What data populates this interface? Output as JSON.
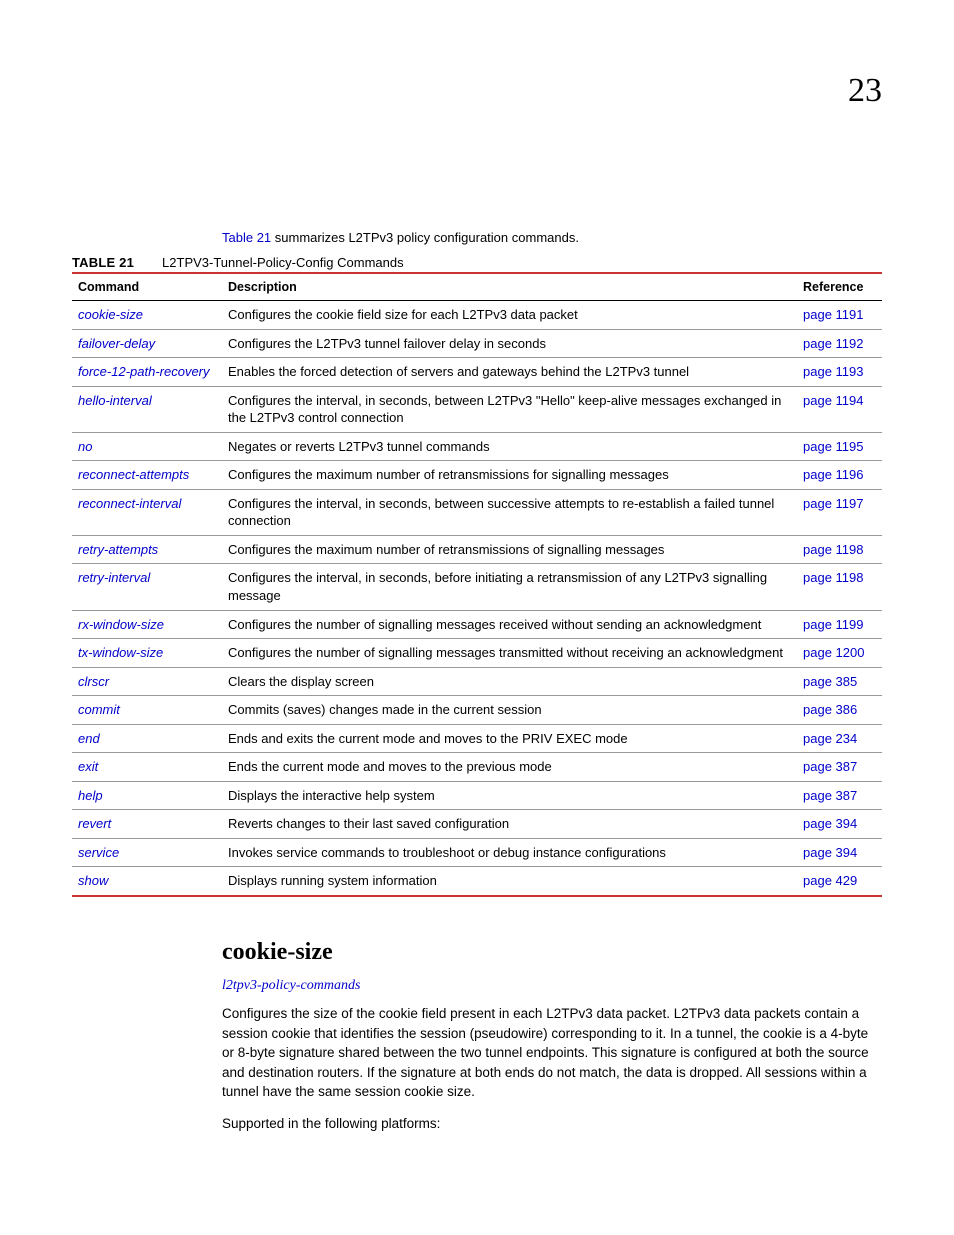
{
  "chapter": "23",
  "intro": {
    "link": "Table 21",
    "rest": " summarizes L2TPv3 policy configuration commands."
  },
  "table": {
    "label": "TABLE 21",
    "title": "L2TPV3-Tunnel-Policy-Config Commands",
    "headers": {
      "cmd": "Command",
      "desc": "Description",
      "ref": "Reference"
    },
    "rows": [
      {
        "cmd": "cookie-size",
        "desc": "Configures the cookie field size for each L2TPv3 data packet",
        "ref": "page 1191"
      },
      {
        "cmd": "failover-delay",
        "desc": "Configures the L2TPv3 tunnel failover delay in seconds",
        "ref": "page 1192"
      },
      {
        "cmd": "force-12-path-recovery",
        "desc": "Enables the forced detection of servers and gateways behind the L2TPv3 tunnel",
        "ref": "page 1193"
      },
      {
        "cmd": "hello-interval",
        "desc": "Configures the interval, in seconds, between L2TPv3 \"Hello\" keep-alive messages exchanged in the L2TPv3 control connection",
        "ref": "page 1194"
      },
      {
        "cmd": "no",
        "desc": "Negates or reverts L2TPv3 tunnel commands",
        "ref": "page 1195"
      },
      {
        "cmd": "reconnect-attempts",
        "desc": "Configures the maximum number of retransmissions for signalling messages",
        "ref": "page 1196"
      },
      {
        "cmd": "reconnect-interval",
        "desc": "Configures the interval, in seconds, between successive attempts to re-establish a failed tunnel connection",
        "ref": "page 1197"
      },
      {
        "cmd": "retry-attempts",
        "desc": "Configures the maximum number of retransmissions of signalling messages",
        "ref": "page 1198"
      },
      {
        "cmd": "retry-interval",
        "desc": "Configures the interval, in seconds, before initiating a retransmission of any L2TPv3 signalling message",
        "ref": "page 1198"
      },
      {
        "cmd": "rx-window-size",
        "desc": "Configures the number of signalling messages received without sending an acknowledgment",
        "ref": "page 1199"
      },
      {
        "cmd": "tx-window-size",
        "desc": "Configures the number of signalling messages transmitted without receiving an acknowledgment",
        "ref": "page 1200"
      },
      {
        "cmd": "clrscr",
        "desc": "Clears the display screen",
        "ref": "page 385"
      },
      {
        "cmd": "commit",
        "desc": "Commits (saves) changes made in the current session",
        "ref": "page 386"
      },
      {
        "cmd": "end",
        "desc": "Ends and exits the current mode and moves to the PRIV EXEC mode",
        "ref": "page 234"
      },
      {
        "cmd": "exit",
        "desc": "Ends the current mode and moves to the previous mode",
        "ref": "page 387"
      },
      {
        "cmd": "help",
        "desc": "Displays the interactive help system",
        "ref": "page 387"
      },
      {
        "cmd": "revert",
        "desc": "Reverts changes to their last saved configuration",
        "ref": "page 394"
      },
      {
        "cmd": "service",
        "desc": "Invokes service commands to troubleshoot or debug                                  instance configurations",
        "ref": "page 394"
      },
      {
        "cmd": "show",
        "desc": "Displays running system information",
        "ref": "page 429"
      }
    ]
  },
  "section": {
    "heading": "cookie-size",
    "subLink": "l2tpv3-policy-commands",
    "para1": "Configures the size of the cookie field present in each L2TPv3 data packet. L2TPv3 data packets contain a session cookie that identifies the session (pseudowire) corresponding to it. In a tunnel, the cookie is a 4-byte or 8-byte signature shared between the two tunnel endpoints. This signature is configured at both the source and destination routers. If the signature at both ends do not match, the data is dropped. All sessions within a tunnel have the same session cookie size.",
    "para2": "Supported in the following platforms:"
  }
}
